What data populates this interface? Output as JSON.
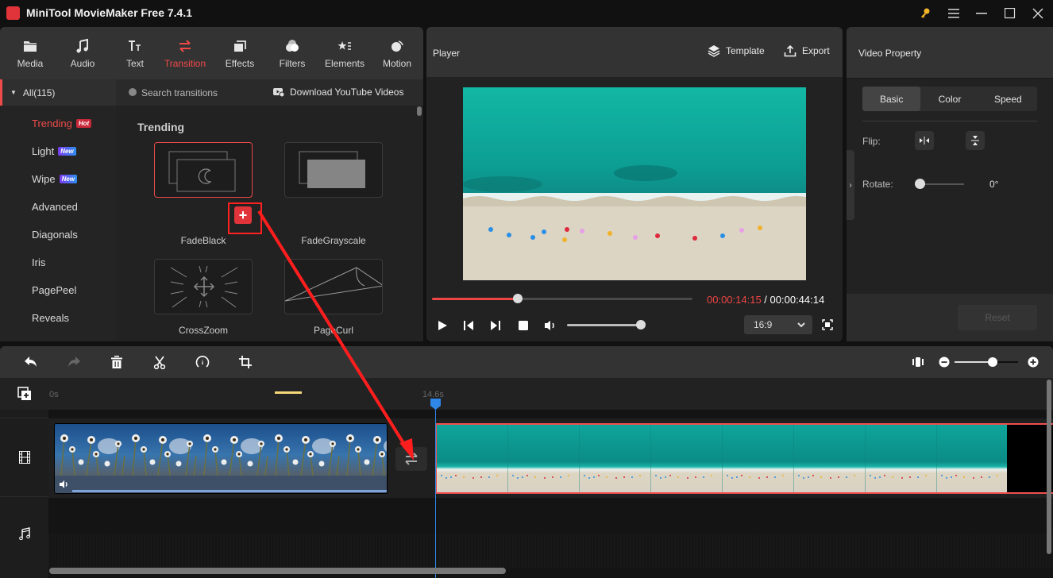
{
  "app": {
    "title": "MiniTool MovieMaker Free 7.4.1",
    "icons": {
      "key": "key-icon",
      "menu": "hamburger-menu-icon",
      "minimize": "minimize-icon",
      "maximize": "maximize-icon",
      "close": "close-icon"
    }
  },
  "toolbar": {
    "tabs": [
      {
        "label": "Media",
        "icon": "folder-icon"
      },
      {
        "label": "Audio",
        "icon": "music-note-icon"
      },
      {
        "label": "Text",
        "icon": "text-icon"
      },
      {
        "label": "Transition",
        "icon": "transition-arrows-icon",
        "active": true
      },
      {
        "label": "Effects",
        "icon": "effects-icon"
      },
      {
        "label": "Filters",
        "icon": "filters-icon"
      },
      {
        "label": "Elements",
        "icon": "elements-icon"
      },
      {
        "label": "Motion",
        "icon": "motion-icon"
      }
    ]
  },
  "library": {
    "category_header": "All(115)",
    "categories": [
      {
        "label": "Trending",
        "badge": "Hot",
        "active": true
      },
      {
        "label": "Light",
        "badge": "New"
      },
      {
        "label": "Wipe",
        "badge": "New"
      },
      {
        "label": "Advanced"
      },
      {
        "label": "Diagonals"
      },
      {
        "label": "Iris"
      },
      {
        "label": "PagePeel"
      },
      {
        "label": "Reveals"
      }
    ],
    "search_placeholder": "Search transitions",
    "download_label": "Download YouTube Videos",
    "section_title": "Trending",
    "items": [
      {
        "label": "FadeBlack",
        "selected": true
      },
      {
        "label": "FadeGrayscale"
      },
      {
        "label": "CrossZoom"
      },
      {
        "label": "PageCurl"
      }
    ],
    "add_label": "+"
  },
  "player": {
    "title": "Player",
    "template_label": "Template",
    "export_label": "Export",
    "current_time": "00:00:14:15",
    "separator": " / ",
    "total_time": "00:00:44:14",
    "progress_fraction": 0.33,
    "volume_fraction": 0.99,
    "aspect_ratio": "16:9"
  },
  "property": {
    "title": "Video Property",
    "tabs": [
      {
        "label": "Basic",
        "active": true
      },
      {
        "label": "Color"
      },
      {
        "label": "Speed"
      }
    ],
    "flip_label": "Flip:",
    "rotate_label": "Rotate:",
    "rotate_value": "0°",
    "reset_label": "Reset"
  },
  "timeline": {
    "ruler": {
      "start": "0s",
      "playhead": "14.6s"
    },
    "zoom_fraction": 0.6,
    "clips": [
      {
        "name": "flowers-clip",
        "type": "video"
      },
      {
        "name": "beach-clip",
        "type": "video",
        "selected": true
      }
    ]
  },
  "colors": {
    "accent": "#f04545",
    "playhead": "#2f87e8",
    "background": "#111111",
    "panel": "#222222"
  }
}
